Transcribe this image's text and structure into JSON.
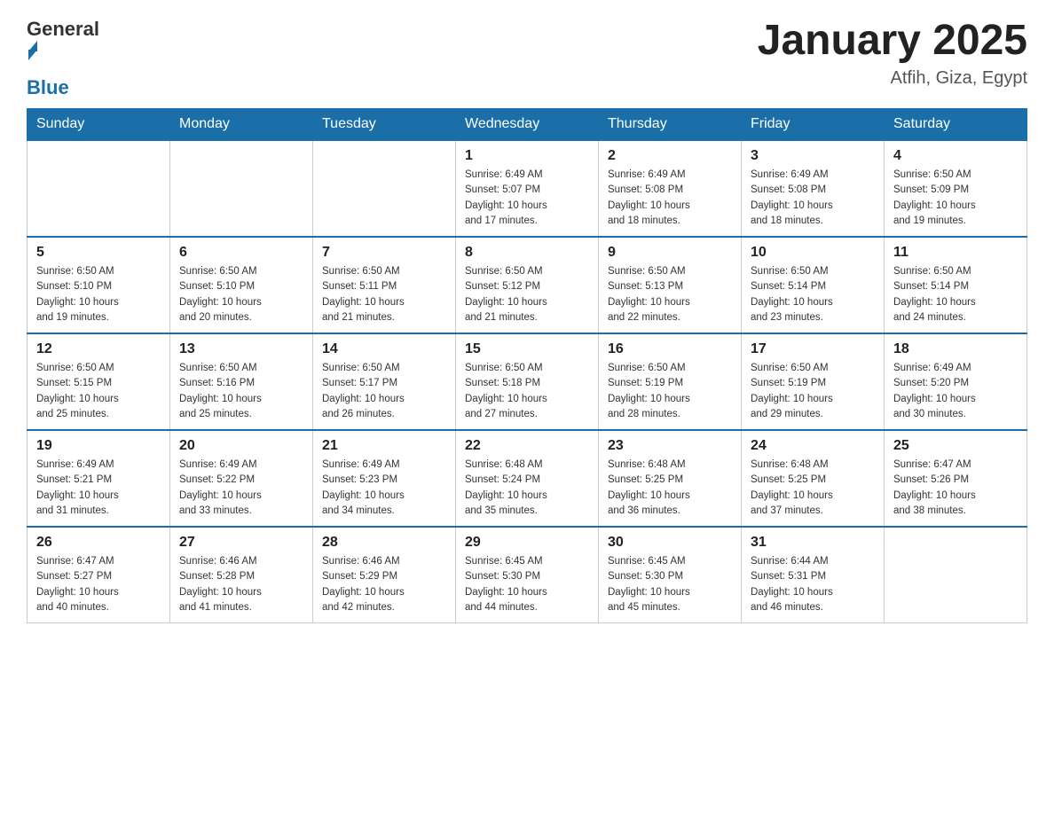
{
  "logo": {
    "text_general": "General",
    "text_blue": "Blue"
  },
  "title": "January 2025",
  "subtitle": "Atfih, Giza, Egypt",
  "days_of_week": [
    "Sunday",
    "Monday",
    "Tuesday",
    "Wednesday",
    "Thursday",
    "Friday",
    "Saturday"
  ],
  "weeks": [
    [
      {
        "day": "",
        "info": ""
      },
      {
        "day": "",
        "info": ""
      },
      {
        "day": "",
        "info": ""
      },
      {
        "day": "1",
        "info": "Sunrise: 6:49 AM\nSunset: 5:07 PM\nDaylight: 10 hours\nand 17 minutes."
      },
      {
        "day": "2",
        "info": "Sunrise: 6:49 AM\nSunset: 5:08 PM\nDaylight: 10 hours\nand 18 minutes."
      },
      {
        "day": "3",
        "info": "Sunrise: 6:49 AM\nSunset: 5:08 PM\nDaylight: 10 hours\nand 18 minutes."
      },
      {
        "day": "4",
        "info": "Sunrise: 6:50 AM\nSunset: 5:09 PM\nDaylight: 10 hours\nand 19 minutes."
      }
    ],
    [
      {
        "day": "5",
        "info": "Sunrise: 6:50 AM\nSunset: 5:10 PM\nDaylight: 10 hours\nand 19 minutes."
      },
      {
        "day": "6",
        "info": "Sunrise: 6:50 AM\nSunset: 5:10 PM\nDaylight: 10 hours\nand 20 minutes."
      },
      {
        "day": "7",
        "info": "Sunrise: 6:50 AM\nSunset: 5:11 PM\nDaylight: 10 hours\nand 21 minutes."
      },
      {
        "day": "8",
        "info": "Sunrise: 6:50 AM\nSunset: 5:12 PM\nDaylight: 10 hours\nand 21 minutes."
      },
      {
        "day": "9",
        "info": "Sunrise: 6:50 AM\nSunset: 5:13 PM\nDaylight: 10 hours\nand 22 minutes."
      },
      {
        "day": "10",
        "info": "Sunrise: 6:50 AM\nSunset: 5:14 PM\nDaylight: 10 hours\nand 23 minutes."
      },
      {
        "day": "11",
        "info": "Sunrise: 6:50 AM\nSunset: 5:14 PM\nDaylight: 10 hours\nand 24 minutes."
      }
    ],
    [
      {
        "day": "12",
        "info": "Sunrise: 6:50 AM\nSunset: 5:15 PM\nDaylight: 10 hours\nand 25 minutes."
      },
      {
        "day": "13",
        "info": "Sunrise: 6:50 AM\nSunset: 5:16 PM\nDaylight: 10 hours\nand 25 minutes."
      },
      {
        "day": "14",
        "info": "Sunrise: 6:50 AM\nSunset: 5:17 PM\nDaylight: 10 hours\nand 26 minutes."
      },
      {
        "day": "15",
        "info": "Sunrise: 6:50 AM\nSunset: 5:18 PM\nDaylight: 10 hours\nand 27 minutes."
      },
      {
        "day": "16",
        "info": "Sunrise: 6:50 AM\nSunset: 5:19 PM\nDaylight: 10 hours\nand 28 minutes."
      },
      {
        "day": "17",
        "info": "Sunrise: 6:50 AM\nSunset: 5:19 PM\nDaylight: 10 hours\nand 29 minutes."
      },
      {
        "day": "18",
        "info": "Sunrise: 6:49 AM\nSunset: 5:20 PM\nDaylight: 10 hours\nand 30 minutes."
      }
    ],
    [
      {
        "day": "19",
        "info": "Sunrise: 6:49 AM\nSunset: 5:21 PM\nDaylight: 10 hours\nand 31 minutes."
      },
      {
        "day": "20",
        "info": "Sunrise: 6:49 AM\nSunset: 5:22 PM\nDaylight: 10 hours\nand 33 minutes."
      },
      {
        "day": "21",
        "info": "Sunrise: 6:49 AM\nSunset: 5:23 PM\nDaylight: 10 hours\nand 34 minutes."
      },
      {
        "day": "22",
        "info": "Sunrise: 6:48 AM\nSunset: 5:24 PM\nDaylight: 10 hours\nand 35 minutes."
      },
      {
        "day": "23",
        "info": "Sunrise: 6:48 AM\nSunset: 5:25 PM\nDaylight: 10 hours\nand 36 minutes."
      },
      {
        "day": "24",
        "info": "Sunrise: 6:48 AM\nSunset: 5:25 PM\nDaylight: 10 hours\nand 37 minutes."
      },
      {
        "day": "25",
        "info": "Sunrise: 6:47 AM\nSunset: 5:26 PM\nDaylight: 10 hours\nand 38 minutes."
      }
    ],
    [
      {
        "day": "26",
        "info": "Sunrise: 6:47 AM\nSunset: 5:27 PM\nDaylight: 10 hours\nand 40 minutes."
      },
      {
        "day": "27",
        "info": "Sunrise: 6:46 AM\nSunset: 5:28 PM\nDaylight: 10 hours\nand 41 minutes."
      },
      {
        "day": "28",
        "info": "Sunrise: 6:46 AM\nSunset: 5:29 PM\nDaylight: 10 hours\nand 42 minutes."
      },
      {
        "day": "29",
        "info": "Sunrise: 6:45 AM\nSunset: 5:30 PM\nDaylight: 10 hours\nand 44 minutes."
      },
      {
        "day": "30",
        "info": "Sunrise: 6:45 AM\nSunset: 5:30 PM\nDaylight: 10 hours\nand 45 minutes."
      },
      {
        "day": "31",
        "info": "Sunrise: 6:44 AM\nSunset: 5:31 PM\nDaylight: 10 hours\nand 46 minutes."
      },
      {
        "day": "",
        "info": ""
      }
    ]
  ]
}
